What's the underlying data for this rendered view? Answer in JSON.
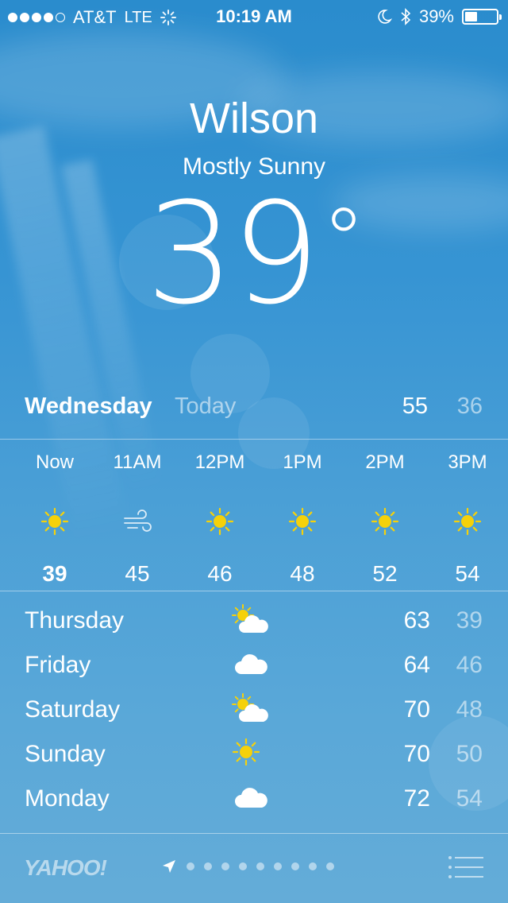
{
  "status_bar": {
    "signal_filled": 4,
    "signal_total": 5,
    "carrier": "AT&T",
    "network": "LTE",
    "time": "10:19 AM",
    "battery_percent_label": "39%",
    "battery_level": 0.39
  },
  "location": {
    "city": "Wilson",
    "condition": "Mostly Sunny",
    "temperature": "39",
    "degree_symbol": "°"
  },
  "today": {
    "day": "Wednesday",
    "label": "Today",
    "high": "55",
    "low": "36"
  },
  "hourly": [
    {
      "time": "Now",
      "icon": "sun-icon",
      "temp": "39"
    },
    {
      "time": "11AM",
      "icon": "wind-icon",
      "temp": "45"
    },
    {
      "time": "12PM",
      "icon": "sun-icon",
      "temp": "46"
    },
    {
      "time": "1PM",
      "icon": "sun-icon",
      "temp": "48"
    },
    {
      "time": "2PM",
      "icon": "sun-icon",
      "temp": "52"
    },
    {
      "time": "3PM",
      "icon": "sun-icon",
      "temp": "54"
    }
  ],
  "daily": [
    {
      "day": "Thursday",
      "icon": "partly-cloudy-icon",
      "high": "63",
      "low": "39"
    },
    {
      "day": "Friday",
      "icon": "cloud-icon",
      "high": "64",
      "low": "46"
    },
    {
      "day": "Saturday",
      "icon": "partly-cloudy-icon",
      "high": "70",
      "low": "48"
    },
    {
      "day": "Sunday",
      "icon": "sun-icon",
      "high": "70",
      "low": "50"
    },
    {
      "day": "Monday",
      "icon": "cloud-icon",
      "high": "72",
      "low": "54"
    }
  ],
  "footer": {
    "brand": "YAHOO!",
    "page_dots": 9
  },
  "colors": {
    "sun": "#f5d10a",
    "sky_top": "#2a8ccd",
    "sky_bottom": "#64acd8"
  }
}
